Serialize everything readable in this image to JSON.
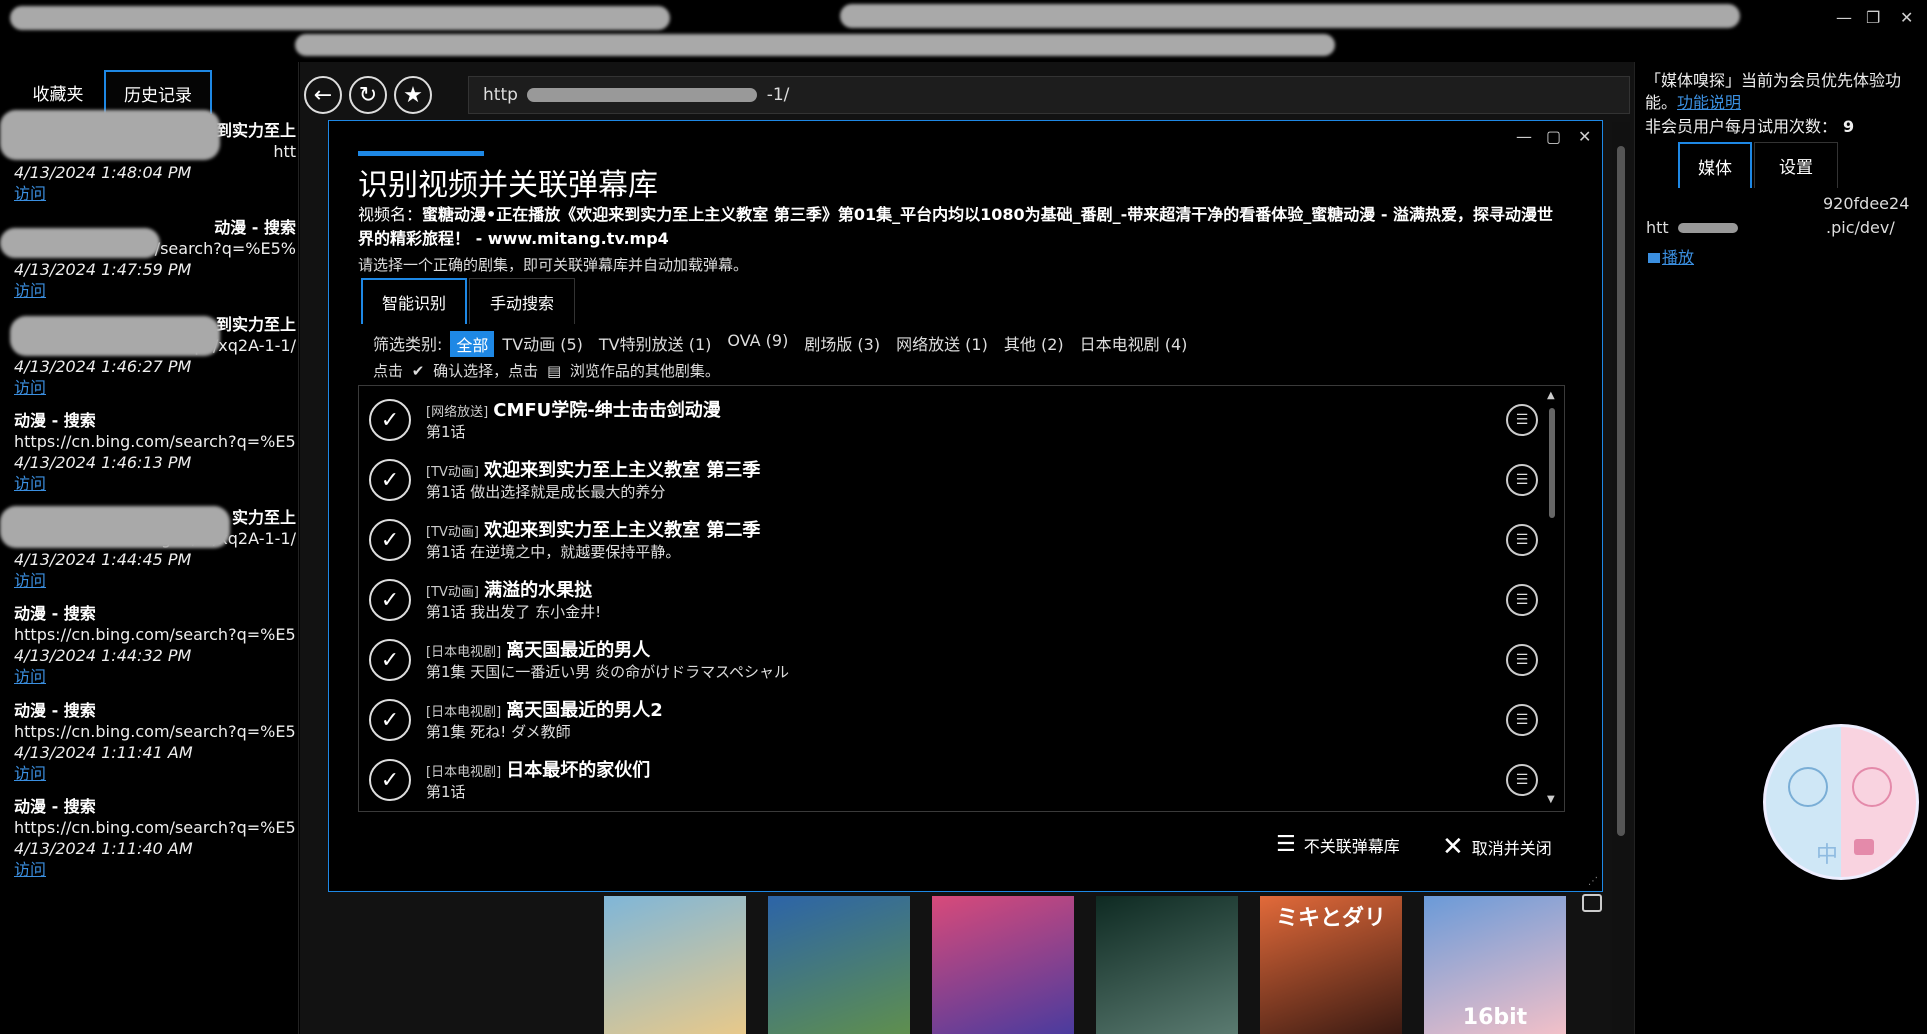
{
  "window_controls": {
    "minimize": "—",
    "restore": "❐",
    "close": "✕"
  },
  "left": {
    "tabs": [
      {
        "label": "收藏夹"
      },
      {
        "label": "历史记录"
      }
    ],
    "history": [
      {
        "title": "到实力至上",
        "url": "htt",
        "date": "4/13/2024 1:48:04 PM",
        "visit": "访问"
      },
      {
        "title": "动漫 - 搜索",
        "url": "/search?q=%E5%",
        "date": "4/13/2024 1:47:59 PM",
        "visit": "访问"
      },
      {
        "title": "到实力至上",
        "url": "https/xq2A-1-1/",
        "date": "4/13/2024 1:46:27 PM",
        "visit": "访问"
      },
      {
        "title": "动漫 - 搜索",
        "url": "https://cn.bing.com/search?q=%E5%",
        "date": "4/13/2024 1:46:13 PM",
        "visit": "访问"
      },
      {
        "title": "实力至上",
        "url": "mitang.tv/m/xq2A-1-1/",
        "date": "4/13/2024 1:44:45 PM",
        "visit": "访问"
      },
      {
        "title": "动漫 - 搜索",
        "url": "https://cn.bing.com/search?q=%E5%",
        "date": "4/13/2024 1:44:32 PM",
        "visit": "访问"
      },
      {
        "title": "动漫 - 搜索",
        "url": "https://cn.bing.com/search?q=%E5%",
        "date": "4/13/2024 1:11:41 AM",
        "visit": "访问"
      },
      {
        "title": "动漫 - 搜索",
        "url": "https://cn.bing.com/search?q=%E5%",
        "date": "4/13/2024 1:11:40 AM",
        "visit": "访问"
      }
    ]
  },
  "browser": {
    "nav": {
      "back": "←",
      "reload": "↻",
      "favorite": "★"
    },
    "url": "http",
    "url_tail": "-1/"
  },
  "right": {
    "notice": "「媒体嗅探」当前为会员优先体验功能。",
    "notice_link": "功能说明",
    "trial_label": "非会员用户每月试用次数：",
    "trial_count": "9",
    "tabs": [
      {
        "label": "媒体"
      },
      {
        "label": "设置"
      }
    ],
    "media_fragment": "920fdee24",
    "media_url": "htt",
    "media_url_tail": ".pic/dev/",
    "play_link": "播放",
    "badge_text": "中"
  },
  "modal": {
    "title": "识别视频并关联弹幕库",
    "video_name_label": "视频名：",
    "video_name": "蜜糖动漫•正在播放《欢迎来到实力至上主义教室 第三季》第01集_平台内均以1080为基础_番剧_-带来超清干净的看番体验_蜜糖动漫 - 溢满热爱，探寻动漫世界的精彩旅程！ - www.mitang.tv.mp4",
    "hint": "请选择一个正确的剧集，即可关联弹幕库并自动加载弹幕。",
    "tabs": [
      {
        "label": "智能识别"
      },
      {
        "label": "手动搜索"
      }
    ],
    "filter_label": "筛选类别:",
    "filters": [
      "全部",
      "TV动画 (5)",
      "TV特别放送 (1)",
      "OVA (9)",
      "剧场版 (3)",
      "网络放送 (1)",
      "其他 (2)",
      "日本电视剧 (4)"
    ],
    "tip_prefix": "点击",
    "tip_mid": "确认选择，点击",
    "tip_suffix": "浏览作品的其他剧集。",
    "results": [
      {
        "tag": "[网络放送]",
        "title": "CMFU学院-绅士击击剑动漫",
        "episode": "第1话"
      },
      {
        "tag": "[TV动画]",
        "title": "欢迎来到实力至上主义教室 第三季",
        "episode": "第1话 做出选择就是成长最大的养分"
      },
      {
        "tag": "[TV动画]",
        "title": "欢迎来到实力至上主义教室 第二季",
        "episode": "第1话 在逆境之中，就越要保持平静。"
      },
      {
        "tag": "[TV动画]",
        "title": "满溢的水果挞",
        "episode": "第1话 我出发了 东小金井!"
      },
      {
        "tag": "[日本电视剧]",
        "title": "离天国最近的男人",
        "episode": "第1集 天国に一番近い男 炎の命がけドラマスペシャル"
      },
      {
        "tag": "[日本电视剧]",
        "title": "离天国最近的男人2",
        "episode": "第1集 死ね! ダメ教師"
      },
      {
        "tag": "[日本电视剧]",
        "title": "日本最坏的家伙们",
        "episode": "第1话"
      }
    ],
    "unlink_button": "不关联弹幕库",
    "cancel_button": "取消并关闭"
  },
  "thumbnails": [
    {
      "colors": [
        "#7fb6d8",
        "#e8c98a"
      ],
      "caption": ""
    },
    {
      "colors": [
        "#2c64a8",
        "#5f8f4e"
      ],
      "caption": ""
    },
    {
      "colors": [
        "#d84a7a",
        "#4a3b9e"
      ],
      "caption": ""
    },
    {
      "colors": [
        "#0e2a22",
        "#5a7a70"
      ],
      "caption": ""
    },
    {
      "colors": [
        "#e26a3a",
        "#3a1a12"
      ],
      "caption": "ミキとダリ"
    },
    {
      "colors": [
        "#6a9ad8",
        "#f2c0c8"
      ],
      "caption": "16bit"
    }
  ]
}
